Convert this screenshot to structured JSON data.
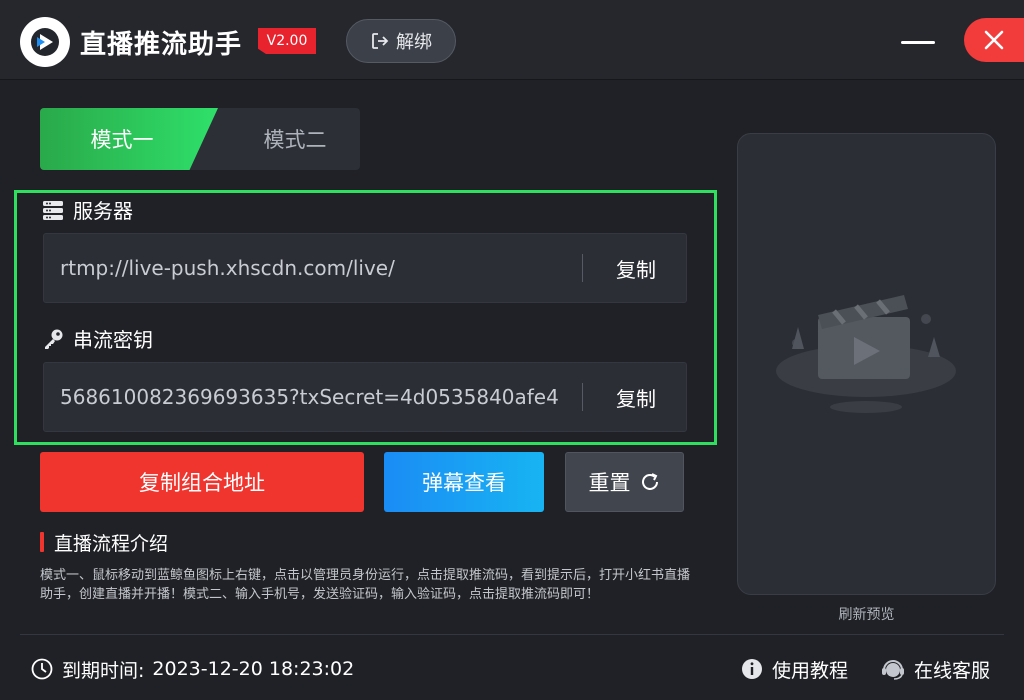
{
  "header": {
    "app_title": "直播推流助手",
    "version": "V2.00",
    "unbind_label": "解绑"
  },
  "tabs": [
    {
      "label": "模式一",
      "active": true
    },
    {
      "label": "模式二",
      "active": false
    }
  ],
  "server": {
    "label": "服务器",
    "value": "rtmp://live-push.xhscdn.com/live/",
    "copy_label": "复制"
  },
  "stream_key": {
    "label": "串流密钥",
    "value": "568610082369693635?txSecret=4d0535840afe4",
    "copy_label": "复制"
  },
  "actions": {
    "copy_combined": "复制组合地址",
    "danmaku": "弹幕查看",
    "reset": "重置"
  },
  "flow": {
    "title": "直播流程介绍",
    "description": "模式一、鼠标移动到蓝鲸鱼图标上右键，点击以管理员身份运行，点击提取推流码，看到提示后，打开小红书直播助手，创建直播并开播！模式二、输入手机号，发送验证码，输入验证码，点击提取推流码即可！"
  },
  "preview": {
    "refresh_label": "刷新预览"
  },
  "footer": {
    "expiry_label": "到期时间:",
    "expiry_value": "2023-12-20 18:23:02",
    "tutorial_label": "使用教程",
    "service_label": "在线客服"
  },
  "colors": {
    "accent_green": "#2fe05e",
    "accent_red": "#f0352f",
    "accent_blue": "#1a8cf5",
    "background": "#1f2126"
  }
}
